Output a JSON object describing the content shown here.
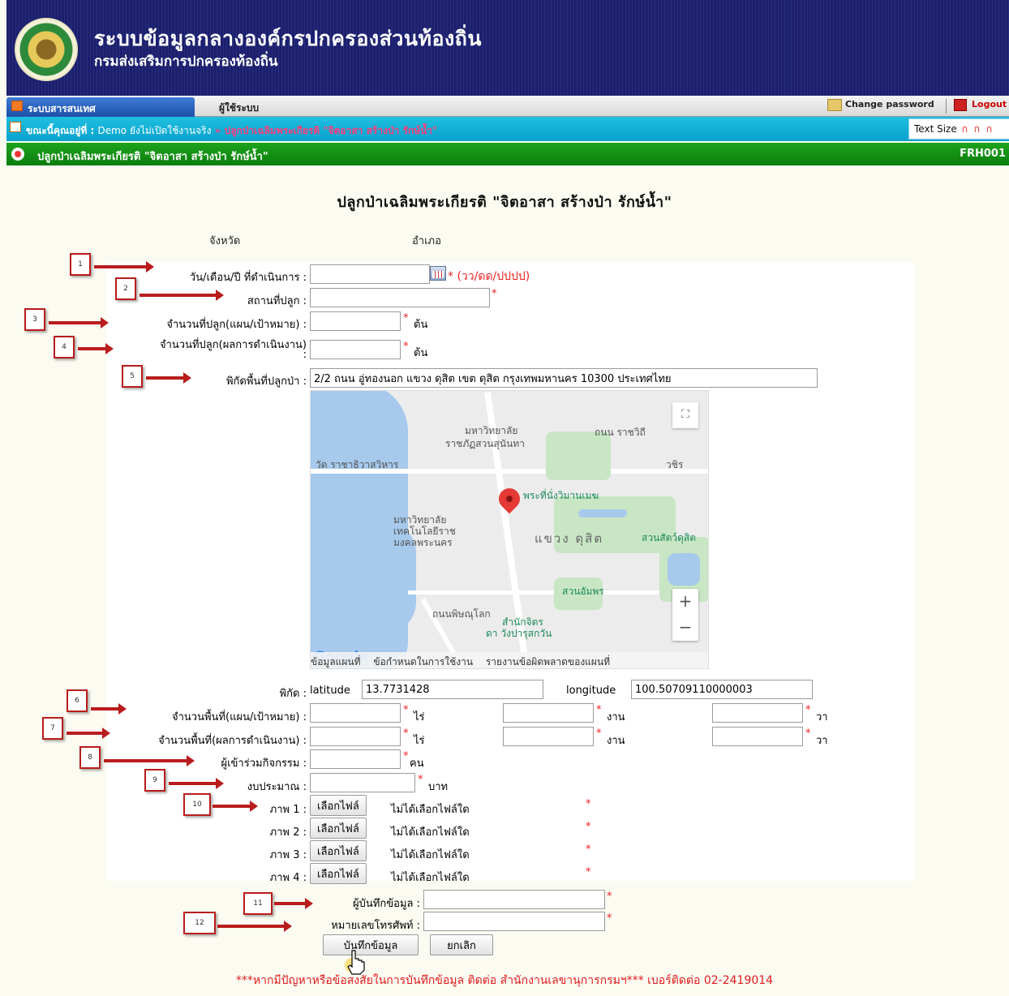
{
  "header": {
    "system_title": "ระบบข้อมูลกลางองค์กรปกครองส่วนท้องถิ่น",
    "system_subtitle": "กรมส่งเสริมการปกครองท้องถิ่น"
  },
  "menu": {
    "active_tab": "ระบบสารสนเทศ",
    "user_tab": "ผู้ใช้ระบบ",
    "change_password": "Change password",
    "logout": "Logout"
  },
  "breadcrumb": {
    "label": "ขณะนี้คุณอยู่ที่ :",
    "demo": "Demo ยังไม่เปิดใช้งานจริง",
    "arrow": "»",
    "page": "ปลูกป่าเฉลิมพระเกียรติ \"จิตอาสา สร้างป่า รักษ์น้ำ\"",
    "text_size_label": "Text Size",
    "text_size_options": "ก ก ก"
  },
  "page_bar": {
    "title": "ปลูกป่าเฉลิมพระเกียรติ \"จิตอาสา สร้างป่า รักษ์น้ำ\"",
    "code": "FRH001"
  },
  "form": {
    "heading": "ปลูกป่าเฉลิมพระเกียรติ \"จิตอาสา สร้างป่า รักษ์น้ำ\"",
    "province_label": "จังหวัด",
    "district_label": "อำเภอ",
    "date_label": "วัน/เดือน/ปี ที่ดำเนินการ :",
    "date_value": "",
    "date_hint": "* (วว/ดด/ปปปป)",
    "place_label": "สถานที่ปลูก :",
    "place_value": "",
    "plan_count_label": "จำนวนที่ปลูก(แผน/เป้าหมาย) :",
    "plan_count_value": "",
    "result_count_label": "จำนวนที่ปลูก(ผลการดำเนินงาน)",
    "result_count_colon": ":",
    "result_count_value": "",
    "tree_unit": "ต้น",
    "location_label": "พิกัดพื้นที่ปลูกป่า :",
    "location_value": "2/2 ถนน อู่ทองนอก แขวง ดุสิต เขต ดุสิต กรุงเทพมหานคร 10300 ประเทศไทย",
    "coord_label": "พิกัด :",
    "latitude_label": "latitude",
    "latitude_value": "13.7731428",
    "longitude_label": "longitude",
    "longitude_value": "100.50709110000003",
    "area_plan_label": "จำนวนพื้นที่(แผน/เป้าหมาย) :",
    "area_result_label": "จำนวนพื้นที่(ผลการดำเนินงาน) :",
    "rai_unit": "ไร่",
    "ngan_unit": "งาน",
    "wa_unit": "วา",
    "participants_label": "ผู้เข้าร่วมกิจกรรม :",
    "participants_unit": "คน",
    "budget_label": "งบประมาณ :",
    "budget_unit": "บาท",
    "images": [
      {
        "label": "ภาพ 1 :",
        "button": "เลือกไฟล์",
        "status": "ไม่ได้เลือกไฟล์ใด"
      },
      {
        "label": "ภาพ 2 :",
        "button": "เลือกไฟล์",
        "status": "ไม่ได้เลือกไฟล์ใด"
      },
      {
        "label": "ภาพ 3 :",
        "button": "เลือกไฟล์",
        "status": "ไม่ได้เลือกไฟล์ใด"
      },
      {
        "label": "ภาพ 4 :",
        "button": "เลือกไฟล์",
        "status": "ไม่ได้เลือกไฟล์ใด"
      }
    ],
    "recorder_label": "ผู้บันทึกข้อมูล :",
    "phone_label": "หมายเลขโทรศัพท์ :",
    "save_button": "บันทึกข้อมูล",
    "cancel_button": "ยกเลิก",
    "required_mark": "*"
  },
  "map": {
    "labels": {
      "university1": "มหาวิทยาลัย",
      "university1b": "ราชภัฏสวนสุนันทา",
      "temple": "วัด ราชาธิวาสวิหาร",
      "throne_hall": "พระที่นั่งวิมานเมฆ",
      "university2": "มหาวิทยาลัย",
      "university2b": "เทคโนโลยีราช",
      "university2c": "มงคลพระนคร",
      "district": "แขวง ดุสิต",
      "zoo": "สวนสัตว์ดุสิต",
      "park": "สวนอัมพร",
      "office": "สำนักจิตร",
      "office_b": "ดา วังปารุสกวัน",
      "road1": "ถนน ราชวิถี",
      "road2": "วชิร",
      "road3": "ถนนพิษณุโลก"
    },
    "footer_data": "ข้อมูลแผนที่",
    "footer_terms": "ข้อกำหนดในการใช้งาน",
    "footer_report": "รายงานข้อผิดพลาดของแผนที่",
    "google": "Google",
    "zoom_in": "+",
    "zoom_out": "−",
    "fullscreen": "⛶"
  },
  "annotations": [
    "1",
    "2",
    "3",
    "4",
    "5",
    "6",
    "7",
    "8",
    "9",
    "10",
    "11",
    "12"
  ],
  "bottom_note": "***หากมีปัญหาหรือข้อสงสัยในการบันทึกข้อมูล ติดต่อ สำนักงานเลขานุการกรมฯ*** เบอร์ติดต่อ 02-2419014",
  "colors": {
    "header_bg": "#1b1f6c",
    "crumb_bg": "#08a2cc",
    "page_bar_bg": "#0c7d0c",
    "required": "#e22222",
    "annotation": "#b91c1c"
  }
}
